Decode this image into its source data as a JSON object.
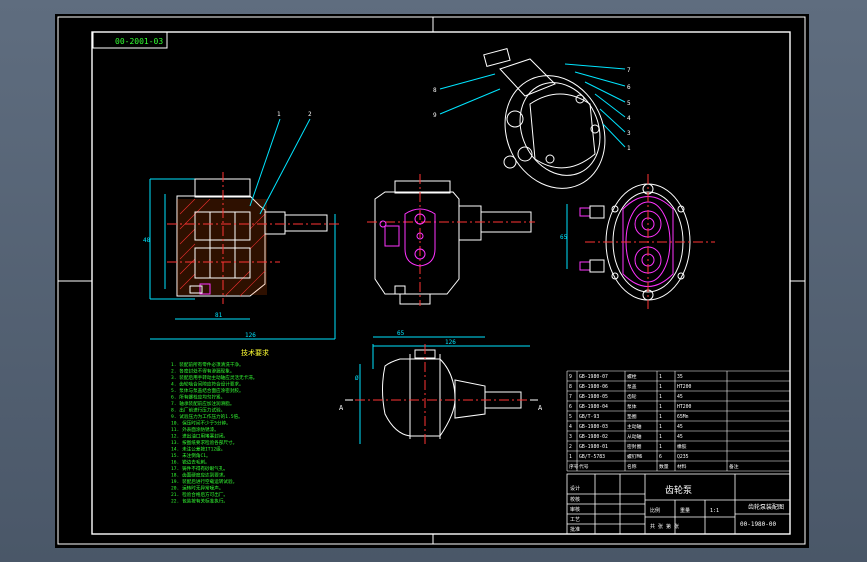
{
  "drawing": {
    "code_box": "00-2001-03",
    "notes_title": "技术要求",
    "notes": [
      "1. 装配前所有零件必须清洗干净。",
      "2. 各密封处不得有渗漏现象。",
      "3. 装配后用手转动主动轴应灵活无卡滞。",
      "4. 齿轮啮合间隙应符合设计要求。",
      "5. 泵体与泵盖结合面应涂密封胶。",
      "6. 所有螺栓应均匀拧紧。",
      "7. 轴承装配前应加注润滑脂。",
      "8. 出厂前进行压力试验。",
      "9. 试验压力为工作压力的1.5倍。",
      "10. 保压时间不少于5分钟。",
      "11. 外表面涂防锈漆。",
      "12. 进出油口用堵塞封闭。",
      "13. 按图纸要求检验各部尺寸。",
      "14. 未注公差按IT12级。",
      "15. 未注倒角C1。",
      "16. 锐边去毛刺。",
      "17. 铸件不得有砂眼气孔。",
      "18. 齿面硬度应达到要求。",
      "19. 装配后进行空载运转试验。",
      "20. 运转时无异常噪声。",
      "21. 检验合格后方可出厂。",
      "22. 包装按有关标准执行。"
    ],
    "callouts_top": [
      "1",
      "2"
    ],
    "callouts_iso_left": [
      "8",
      "9"
    ],
    "callouts_iso_right": [
      "7",
      "6",
      "5",
      "4",
      "3",
      "1"
    ],
    "section_marks": [
      "A",
      "A"
    ],
    "bom": {
      "rows": [
        [
          "9",
          "GB-1980-07",
          "螺栓",
          "1",
          "35",
          ""
        ],
        [
          "8",
          "GB-1980-06",
          "泵盖",
          "1",
          "HT200",
          ""
        ],
        [
          "7",
          "GB-1980-05",
          "齿轮",
          "1",
          "45",
          ""
        ],
        [
          "6",
          "GB-1980-04",
          "泵体",
          "1",
          "HT200",
          ""
        ],
        [
          "5",
          "GB/T-93",
          "垫圈",
          "1",
          "65Mn",
          ""
        ],
        [
          "4",
          "GB-1980-03",
          "主动轴",
          "1",
          "45",
          ""
        ],
        [
          "3",
          "GB-1980-02",
          "从动轴",
          "1",
          "45",
          ""
        ],
        [
          "2",
          "GB-1980-01",
          "密封圈",
          "1",
          "橡胶",
          ""
        ],
        [
          "1",
          "GB/T-5783",
          "螺钉M6",
          "6",
          "Q235",
          ""
        ]
      ],
      "header": [
        "序号",
        "代号",
        "名称",
        "数量",
        "材料",
        "备注"
      ]
    },
    "title_block": {
      "drawing_name": "齿轮泵",
      "sheet_title": "齿轮泵装配图",
      "drawing_no": "00-1980-00",
      "labels": [
        "设计",
        "校核",
        "审核",
        "工艺",
        "批准"
      ],
      "scale_label": "比例",
      "scale": "1:1",
      "weight_label": "重量",
      "sheet_label": "共 张 第 张"
    }
  }
}
